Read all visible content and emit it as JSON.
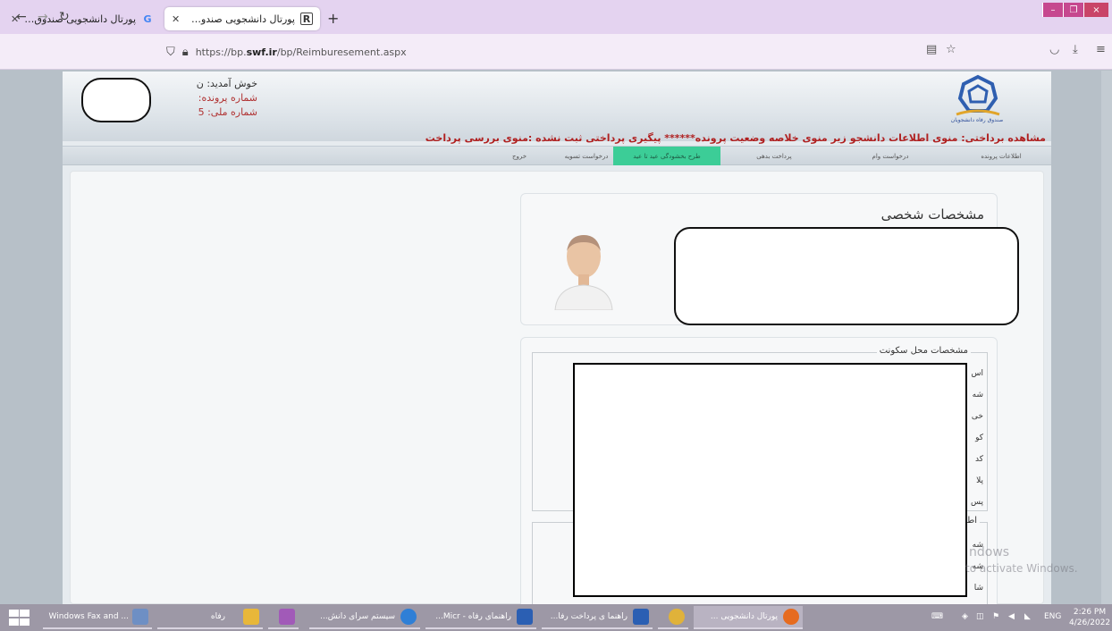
{
  "browser": {
    "tabs": [
      {
        "title": "پورتال دانشجویی صندوق رفاه - G",
        "active": false
      },
      {
        "title": "پورتال دانشجویی صندوق رفاه",
        "active": true
      }
    ],
    "new_tab": "+",
    "url_prefix": "https://bp.",
    "url_domain": "swf.ir",
    "url_path": "/bp/Reimburesement.aspx",
    "window_controls": {
      "minimize": "–",
      "maximize": "❐",
      "close": "×"
    }
  },
  "header": {
    "welcome": "خوش آمدید: ن",
    "file_number": "شماره پرونده:",
    "national_id": "شماره ملی: 5",
    "logo_text": "صندوق رفاه دانشجویان"
  },
  "marquee": "مشاهده برداختی: منوی اطلاعات دانشجو زیر منوی خلاصه وضعیت پرونده****** پیگیری پرداختی ثبت نشده :منوی بررسی پرداخت",
  "menu": [
    {
      "label": "اطلاعات پرونده",
      "active": false
    },
    {
      "label": "درخواست وام",
      "active": false
    },
    {
      "label": "پرداخت بدهی",
      "active": false
    },
    {
      "label": "طرح بخشودگی عید تا عید",
      "active": true
    },
    {
      "label": "درخواست تسویه",
      "active": false
    },
    {
      "label": "خروج",
      "active": false
    }
  ],
  "personal": {
    "title": "مشخصات شخصی"
  },
  "residence": {
    "legend": "مشخصات محل سکونت",
    "row_labels": [
      "اس",
      "شه",
      "خی",
      "کو",
      "کد",
      "پلا",
      "پس"
    ]
  },
  "other": {
    "legend": "اطلا",
    "row_labels": [
      "شه",
      "شه",
      "شا"
    ]
  },
  "watermark": {
    "line1": "ndows",
    "line2": "to activate Windows."
  },
  "taskbar": {
    "items": [
      {
        "label": "Windows Fax and ...",
        "color": "#6e8fc4"
      },
      {
        "label": "رفاه",
        "color": "#e8b73a"
      },
      {
        "label": "سیستم سرای دانش...",
        "color": "#2f7fd6"
      },
      {
        "label": "راهنمای رفاه - Micr...",
        "color": "#2b5fb3"
      },
      {
        "label": "راهنما ی پرداخت رفا...",
        "color": "#2b5fb3"
      },
      {
        "label": "پورتال دانشجویی ...",
        "color": "#e66b1f"
      }
    ],
    "lang": "ENG",
    "time": "2:26 PM",
    "date": "4/26/2022"
  },
  "colors": {
    "menu_active": "#3ccd97",
    "marquee": "#b02020",
    "tabbar": "#e4d3f0"
  }
}
